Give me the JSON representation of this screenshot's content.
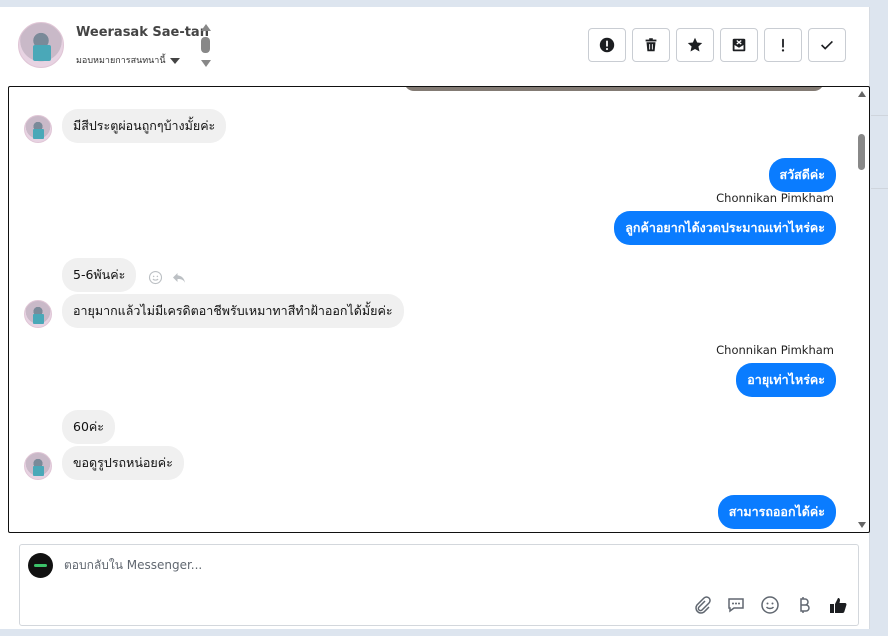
{
  "header": {
    "customer_name": "Weerasak Sae-tan",
    "assign_label": "มอบหมายการสนทนานี้"
  },
  "toolbar": {
    "buttons": [
      {
        "name": "mark-spam",
        "icon": "exclamation-circle-icon"
      },
      {
        "name": "delete",
        "icon": "trash-icon"
      },
      {
        "name": "star",
        "icon": "star-icon"
      },
      {
        "name": "archive",
        "icon": "envelope-x-icon"
      },
      {
        "name": "flag",
        "icon": "exclamation-icon"
      },
      {
        "name": "done",
        "icon": "check-icon"
      }
    ]
  },
  "messages": [
    {
      "dir": "in",
      "text": "มีสีประตูผ่อนถูกๆบ้างมั้ยค่ะ",
      "avatar": true
    },
    {
      "dir": "out",
      "text": "สวัสดีค่ะ"
    },
    {
      "dir": "out",
      "sender": "Chonnikan Pimkham",
      "text": "ลูกค้าอยากได้งวดประมาณเท่าไหร่คะ"
    },
    {
      "dir": "in",
      "text": "5-6พันค่ะ",
      "avatar": false
    },
    {
      "dir": "in",
      "text": "อายุมากแล้วไม่มีเครดิตอาชีพรับเหมาทาสีทำฝ้าออกได้มั้ยค่ะ",
      "avatar": true
    },
    {
      "dir": "out",
      "sender": "Chonnikan Pimkham",
      "text": "อายุเท่าไหร่คะ"
    },
    {
      "dir": "in",
      "text": "60ค่ะ",
      "avatar": false
    },
    {
      "dir": "in",
      "text": "ขอดูรูปรถหน่อยค่ะ",
      "avatar": true
    },
    {
      "dir": "out",
      "text": "สามารถออกได้ค่ะ"
    }
  ],
  "composer": {
    "placeholder": "ตอบกลับใน Messenger..."
  },
  "colors": {
    "outgoing_bubble": "#0a7cff",
    "incoming_bubble": "#f0f0f0"
  }
}
